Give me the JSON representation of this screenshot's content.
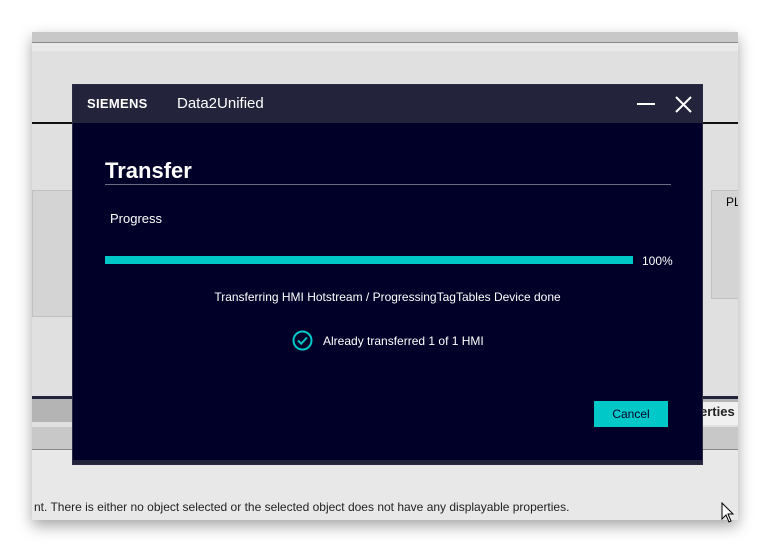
{
  "background": {
    "right_panel_label": "PL",
    "properties_tab": "erties",
    "status_message": "nt. There is either no object selected or the selected object does not have any displayable properties."
  },
  "dialog": {
    "brand": "SIEMENS",
    "app_title": "Data2Unified",
    "heading": "Transfer",
    "progress_label": "Progress",
    "progress_value": 100,
    "progress_text": "100%",
    "status_line": "Transferring HMI Hotstream / ProgressingTagTables Device done",
    "result_line": "Already transferred 1 of 1 HMI",
    "cancel_label": "Cancel",
    "accent": "#00c8c8"
  }
}
